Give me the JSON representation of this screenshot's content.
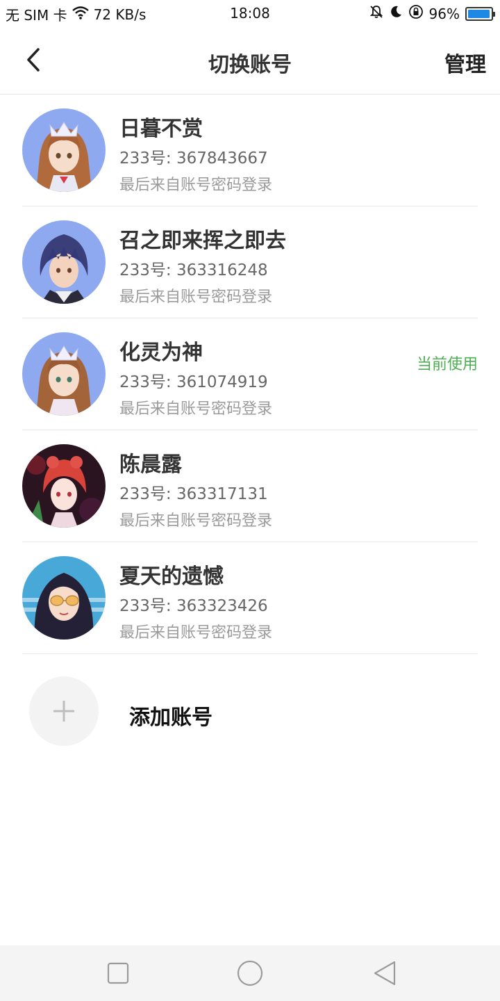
{
  "status_bar": {
    "carrier": "无 SIM 卡",
    "network_speed": "72 KB/s",
    "time": "18:08",
    "battery_percent": "96%",
    "battery_level": 0.96,
    "icons": [
      "wifi-icon",
      "mute-icon",
      "moon-icon",
      "rotation-lock-icon",
      "battery-icon"
    ]
  },
  "header": {
    "title": "切换账号",
    "manage_label": "管理",
    "back_icon": "chevron-left-icon"
  },
  "accounts": [
    {
      "name": "日暮不赏",
      "id": "233号: 367843667",
      "last_login": "最后来自账号密码登录",
      "current": ""
    },
    {
      "name": "召之即来挥之即去",
      "id": "233号: 363316248",
      "last_login": "最后来自账号密码登录",
      "current": ""
    },
    {
      "name": "化灵为神",
      "id": "233号: 361074919",
      "last_login": "最后来自账号密码登录",
      "current": "当前使用"
    },
    {
      "name": "陈晨露",
      "id": "233号: 363317131",
      "last_login": "最后来自账号密码登录",
      "current": ""
    },
    {
      "name": "夏天的遗憾",
      "id": "233号: 363323426",
      "last_login": "最后来自账号密码登录",
      "current": ""
    }
  ],
  "add_account": {
    "label": "添加账号",
    "icon": "plus-icon"
  },
  "nav_bar": {
    "icons": [
      "recents-square-icon",
      "home-circle-icon",
      "back-triangle-icon"
    ]
  },
  "colors": {
    "current_badge": "#4caf50",
    "battery_fill": "#1e88e5",
    "divider": "#e8e8e8",
    "avatar_bg_blue": "#8ea9f0"
  }
}
